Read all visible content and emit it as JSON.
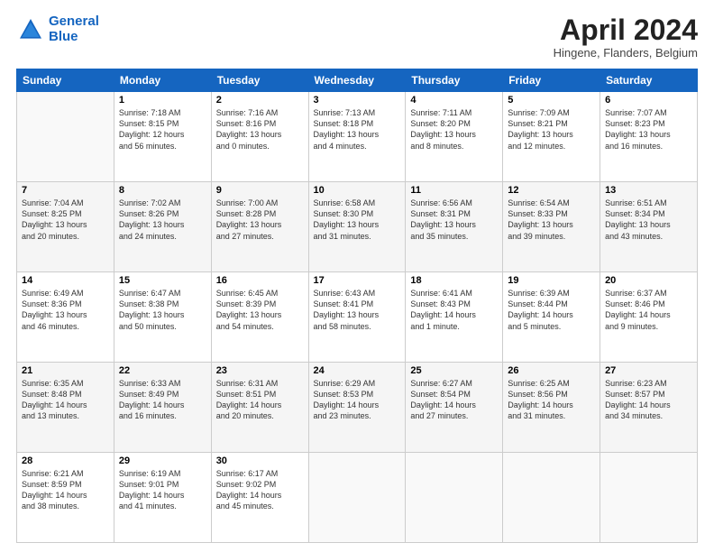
{
  "header": {
    "logo_line1": "General",
    "logo_line2": "Blue",
    "month": "April 2024",
    "location": "Hingene, Flanders, Belgium"
  },
  "days_of_week": [
    "Sunday",
    "Monday",
    "Tuesday",
    "Wednesday",
    "Thursday",
    "Friday",
    "Saturday"
  ],
  "weeks": [
    [
      {
        "day": "",
        "info": ""
      },
      {
        "day": "1",
        "info": "Sunrise: 7:18 AM\nSunset: 8:15 PM\nDaylight: 12 hours\nand 56 minutes."
      },
      {
        "day": "2",
        "info": "Sunrise: 7:16 AM\nSunset: 8:16 PM\nDaylight: 13 hours\nand 0 minutes."
      },
      {
        "day": "3",
        "info": "Sunrise: 7:13 AM\nSunset: 8:18 PM\nDaylight: 13 hours\nand 4 minutes."
      },
      {
        "day": "4",
        "info": "Sunrise: 7:11 AM\nSunset: 8:20 PM\nDaylight: 13 hours\nand 8 minutes."
      },
      {
        "day": "5",
        "info": "Sunrise: 7:09 AM\nSunset: 8:21 PM\nDaylight: 13 hours\nand 12 minutes."
      },
      {
        "day": "6",
        "info": "Sunrise: 7:07 AM\nSunset: 8:23 PM\nDaylight: 13 hours\nand 16 minutes."
      }
    ],
    [
      {
        "day": "7",
        "info": "Sunrise: 7:04 AM\nSunset: 8:25 PM\nDaylight: 13 hours\nand 20 minutes."
      },
      {
        "day": "8",
        "info": "Sunrise: 7:02 AM\nSunset: 8:26 PM\nDaylight: 13 hours\nand 24 minutes."
      },
      {
        "day": "9",
        "info": "Sunrise: 7:00 AM\nSunset: 8:28 PM\nDaylight: 13 hours\nand 27 minutes."
      },
      {
        "day": "10",
        "info": "Sunrise: 6:58 AM\nSunset: 8:30 PM\nDaylight: 13 hours\nand 31 minutes."
      },
      {
        "day": "11",
        "info": "Sunrise: 6:56 AM\nSunset: 8:31 PM\nDaylight: 13 hours\nand 35 minutes."
      },
      {
        "day": "12",
        "info": "Sunrise: 6:54 AM\nSunset: 8:33 PM\nDaylight: 13 hours\nand 39 minutes."
      },
      {
        "day": "13",
        "info": "Sunrise: 6:51 AM\nSunset: 8:34 PM\nDaylight: 13 hours\nand 43 minutes."
      }
    ],
    [
      {
        "day": "14",
        "info": "Sunrise: 6:49 AM\nSunset: 8:36 PM\nDaylight: 13 hours\nand 46 minutes."
      },
      {
        "day": "15",
        "info": "Sunrise: 6:47 AM\nSunset: 8:38 PM\nDaylight: 13 hours\nand 50 minutes."
      },
      {
        "day": "16",
        "info": "Sunrise: 6:45 AM\nSunset: 8:39 PM\nDaylight: 13 hours\nand 54 minutes."
      },
      {
        "day": "17",
        "info": "Sunrise: 6:43 AM\nSunset: 8:41 PM\nDaylight: 13 hours\nand 58 minutes."
      },
      {
        "day": "18",
        "info": "Sunrise: 6:41 AM\nSunset: 8:43 PM\nDaylight: 14 hours\nand 1 minute."
      },
      {
        "day": "19",
        "info": "Sunrise: 6:39 AM\nSunset: 8:44 PM\nDaylight: 14 hours\nand 5 minutes."
      },
      {
        "day": "20",
        "info": "Sunrise: 6:37 AM\nSunset: 8:46 PM\nDaylight: 14 hours\nand 9 minutes."
      }
    ],
    [
      {
        "day": "21",
        "info": "Sunrise: 6:35 AM\nSunset: 8:48 PM\nDaylight: 14 hours\nand 13 minutes."
      },
      {
        "day": "22",
        "info": "Sunrise: 6:33 AM\nSunset: 8:49 PM\nDaylight: 14 hours\nand 16 minutes."
      },
      {
        "day": "23",
        "info": "Sunrise: 6:31 AM\nSunset: 8:51 PM\nDaylight: 14 hours\nand 20 minutes."
      },
      {
        "day": "24",
        "info": "Sunrise: 6:29 AM\nSunset: 8:53 PM\nDaylight: 14 hours\nand 23 minutes."
      },
      {
        "day": "25",
        "info": "Sunrise: 6:27 AM\nSunset: 8:54 PM\nDaylight: 14 hours\nand 27 minutes."
      },
      {
        "day": "26",
        "info": "Sunrise: 6:25 AM\nSunset: 8:56 PM\nDaylight: 14 hours\nand 31 minutes."
      },
      {
        "day": "27",
        "info": "Sunrise: 6:23 AM\nSunset: 8:57 PM\nDaylight: 14 hours\nand 34 minutes."
      }
    ],
    [
      {
        "day": "28",
        "info": "Sunrise: 6:21 AM\nSunset: 8:59 PM\nDaylight: 14 hours\nand 38 minutes."
      },
      {
        "day": "29",
        "info": "Sunrise: 6:19 AM\nSunset: 9:01 PM\nDaylight: 14 hours\nand 41 minutes."
      },
      {
        "day": "30",
        "info": "Sunrise: 6:17 AM\nSunset: 9:02 PM\nDaylight: 14 hours\nand 45 minutes."
      },
      {
        "day": "",
        "info": ""
      },
      {
        "day": "",
        "info": ""
      },
      {
        "day": "",
        "info": ""
      },
      {
        "day": "",
        "info": ""
      }
    ]
  ]
}
